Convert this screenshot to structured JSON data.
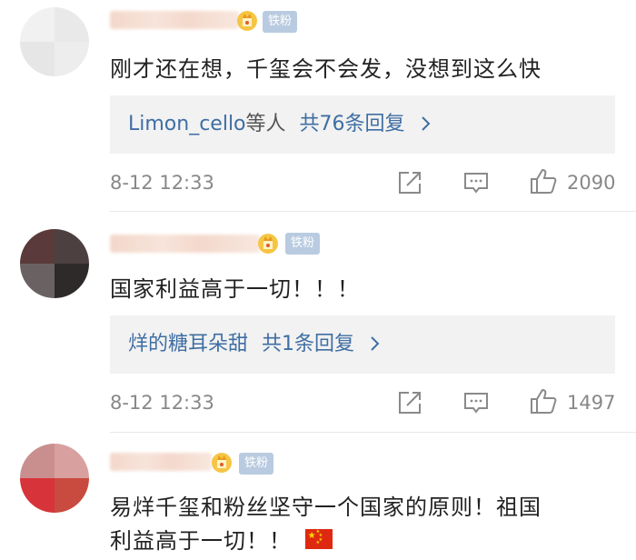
{
  "comments": [
    {
      "badge": "铁粉",
      "text": "刚才还在想，千玺会不会发，没想到这么快",
      "reply_user": "Limon_cello",
      "reply_mid": "等人",
      "reply_count": "共76条回复",
      "time": "8-12 12:33",
      "likes": "2090"
    },
    {
      "badge": "铁粉",
      "text": "国家利益高于一切！！！",
      "reply_user": "烊的糖耳朵甜",
      "reply_count": "共1条回复",
      "time": "8-12 12:33",
      "likes": "1497"
    },
    {
      "badge": "铁粉",
      "text_line1": "易烊千玺和粉丝坚守一个国家的原则！祖国",
      "text_line2": "利益高于一切！！"
    }
  ],
  "icons": [
    "share-icon",
    "comment-icon",
    "like-icon",
    "vip-crown-icon",
    "china-flag-icon"
  ],
  "colors": {
    "link": "#3f6ea3",
    "badge_bg": "#b9cbe0",
    "reply_bg": "#f2f2f2",
    "muted": "#888888"
  }
}
